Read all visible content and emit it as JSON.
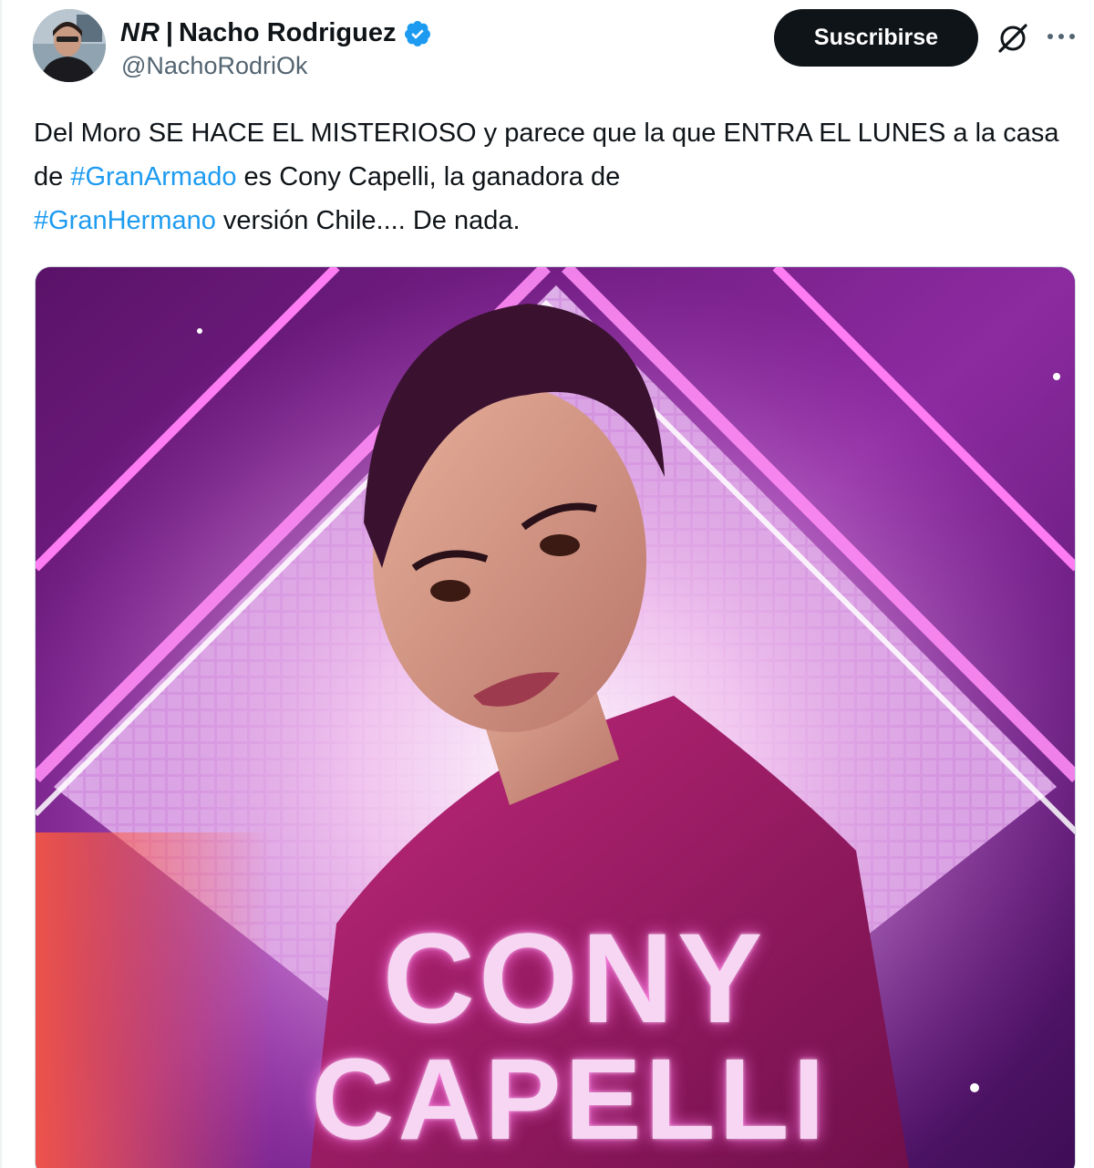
{
  "author": {
    "badge": "NR",
    "separator": "|",
    "name": "Nacho Rodriguez",
    "handle": "@NachoRodriOk",
    "verified": true
  },
  "actions": {
    "subscribe_label": "Suscribirse"
  },
  "tweet": {
    "text_parts": [
      "Del Moro SE HACE EL MISTERIOSO y parece que la que ENTRA EL LUNES a la casa de ",
      " es Cony Capelli, la ganadora de ",
      " versión Chile.... De nada."
    ],
    "hashtags": [
      "#GranArmado",
      "#GranHermano"
    ]
  },
  "media": {
    "first_name": "CONY",
    "last_name": "CAPELLI"
  },
  "colors": {
    "accent": "#1d9bf0",
    "button_bg": "#0f1419",
    "secondary_text": "#536471"
  }
}
